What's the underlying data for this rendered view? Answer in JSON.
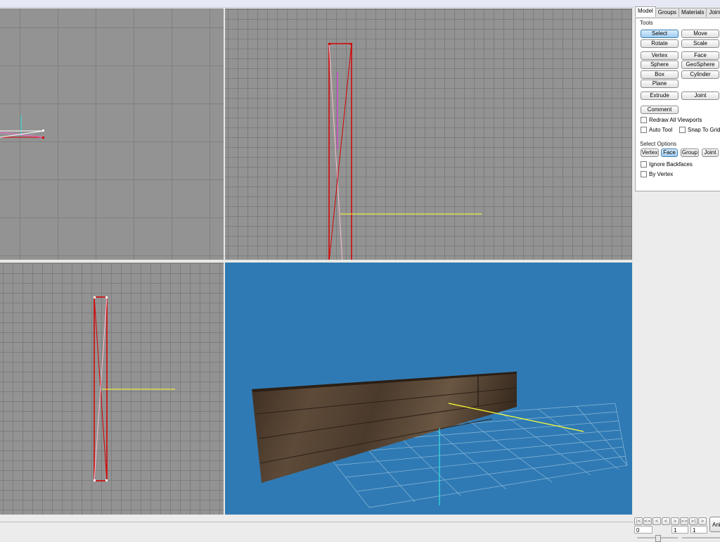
{
  "panel": {
    "tabs": [
      {
        "label": "Model",
        "active": true
      },
      {
        "label": "Groups"
      },
      {
        "label": "Materials"
      },
      {
        "label": "Joints"
      }
    ],
    "tools": {
      "title": "Tools",
      "select": "Select",
      "move": "Move",
      "rotate": "Rotate",
      "scale": "Scale",
      "vertex": "Vertex",
      "face": "Face",
      "sphere": "Sphere",
      "geosphere": "GeoSphere",
      "box": "Box",
      "cylinder": "Cylinder",
      "plane": "Plane",
      "extrude": "Extrude",
      "joint": "Joint",
      "comment": "Comment",
      "redraw": "Redraw All Viewports",
      "auto_tool": "Auto Tool",
      "snap": "Snap To Grid"
    },
    "select_options": {
      "title": "Select Options",
      "vertex": "Vertex",
      "face": "Face",
      "group": "Group",
      "joint": "Joint",
      "ignore_backfaces": "Ignore Backfaces",
      "by_vertex": "By Vertex"
    }
  },
  "status": {
    "nav_buttons": [
      "|<",
      "<<",
      "<",
      "<",
      ">",
      ">>",
      ">|",
      ">"
    ],
    "frame_start": "0",
    "frame_current": "1",
    "frame_end": "1",
    "anim_button": "Ani"
  },
  "colors": {
    "viewport_gray": "#939393",
    "viewport_3d": "#2f7ab4",
    "wire_red": "#d40000",
    "axis_yellow": "#ffff33",
    "axis_cyan": "#31e0e0",
    "button_active": "#9fccf1"
  }
}
